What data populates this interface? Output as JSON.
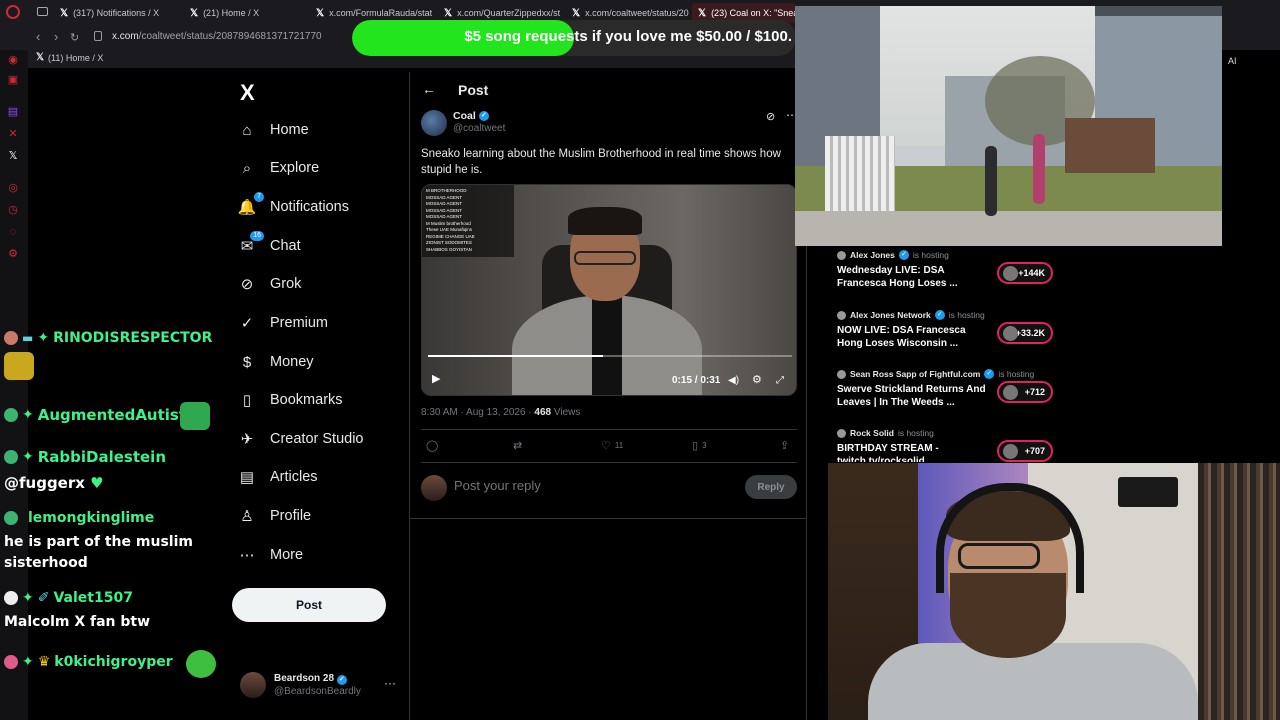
{
  "browser": {
    "tabs": [
      {
        "label": "(317) Notifications / X",
        "active": false
      },
      {
        "label": "(21) Home / X",
        "active": false
      },
      {
        "label": "x.com/FormulaRauda/stat",
        "active": false
      },
      {
        "label": "x.com/QuarterZippedxx/st",
        "active": false
      },
      {
        "label": "x.com/coaltweet/status/20",
        "active": false
      },
      {
        "label": "(23) Coal on X: \"Sneak",
        "active": true
      }
    ],
    "url_host": "x.com",
    "url_path": "/coaltweet/status/2087894681371721770",
    "bookmark": "(11) Home / X",
    "ai_label": "AI"
  },
  "banner": {
    "text": "$5 song requests if you love me $50.00 / $100.",
    "progress": 0.5,
    "color": "#22e51e"
  },
  "chat": {
    "messages": [
      {
        "user": "RINODISRESPECTOR",
        "user_color": "#3df28b",
        "text": ""
      },
      {
        "user": "AugmentedAutist",
        "user_color": "#3df28b",
        "text": ""
      },
      {
        "user": "RabbiDalestein",
        "user_color": "#3df28b",
        "text": "@fuggerx"
      },
      {
        "user": "lemongkinglime",
        "user_color": "#3df28b",
        "text": "he is part of the muslim sisterhood"
      },
      {
        "user": "Valet1507",
        "user_color": "#3df28b",
        "text": "Malcolm X fan btw"
      },
      {
        "user": "k0kichigroyper",
        "user_color": "#3df28b",
        "text": ""
      }
    ],
    "lemong_line1": "he is part of the muslim",
    "lemong_line2": "sisterhood"
  },
  "sidebar": {
    "logo": "X",
    "items": [
      {
        "label": "Home",
        "icon": "home-icon",
        "glyph": "⌂"
      },
      {
        "label": "Explore",
        "icon": "search-icon",
        "glyph": "⌕"
      },
      {
        "label": "Notifications",
        "icon": "bell-icon",
        "glyph": "🔔",
        "badge": "7"
      },
      {
        "label": "Chat",
        "icon": "chat-icon",
        "glyph": "✉",
        "badge": "16"
      },
      {
        "label": "Grok",
        "icon": "grok-icon",
        "glyph": "⊘"
      },
      {
        "label": "Premium",
        "icon": "premium-icon",
        "glyph": "✓"
      },
      {
        "label": "Money",
        "icon": "money-icon",
        "glyph": "$"
      },
      {
        "label": "Bookmarks",
        "icon": "bookmark-icon",
        "glyph": "▯"
      },
      {
        "label": "Creator Studio",
        "icon": "rocket-icon",
        "glyph": "✈"
      },
      {
        "label": "Articles",
        "icon": "article-icon",
        "glyph": "▤"
      },
      {
        "label": "Profile",
        "icon": "profile-icon",
        "glyph": "♙"
      },
      {
        "label": "More",
        "icon": "more-icon",
        "glyph": "⋯"
      }
    ],
    "post_button": "Post",
    "account": {
      "name": "Beardson 28",
      "handle": "@BeardsonBeardly",
      "more": "···"
    }
  },
  "post": {
    "header": "Post",
    "author_name": "Coal",
    "author_handle": "@coaltweet",
    "text": "Sneako learning about the Muslim Brotherhood in real time shows how stupid he is.",
    "video": {
      "overlay_lines": [
        "M BROTHERHOOD",
        "MOSSAD AGENT",
        "MOSSAD AGENT",
        "MOSSAD AGENT",
        "MOSSAD AGENT",
        "M Muslim brotherhood",
        "These UAE Munafiqins",
        "REGIME CHANGE UAE",
        "ZIONIST SODOMITES",
        "SHABBOS GOYISTAN"
      ],
      "time": "0:15 / 0:31",
      "progress": 0.48
    },
    "time": "8:30 AM · Aug 13, 2026 · ",
    "views_count": "468",
    "views_label": " Views",
    "likes": "11",
    "bookmarks": "3",
    "reply_placeholder": "Post your reply",
    "reply_button": "Reply"
  },
  "hosting": {
    "items": [
      {
        "name": "Alex Jones",
        "verified": true,
        "status": "is hosting",
        "title": "Wednesday LIVE: DSA Francesca Hong Loses ...",
        "count": "+144K"
      },
      {
        "name": "Alex Jones Network",
        "verified": true,
        "status": "is hosting",
        "title": "NOW LIVE: DSA Francesca Hong Loses Wisconsin ...",
        "count": "+33.2K"
      },
      {
        "name": "Sean Ross Sapp of Fightful.com",
        "verified": true,
        "status": "is hosting",
        "title": "Swerve Strickland Returns And Leaves | In The Weeds ...",
        "count": "+712"
      },
      {
        "name": "Rock Solid",
        "verified": false,
        "status": "is hosting",
        "title": "BIRTHDAY STREAM - twitch.tv/rocksolid",
        "count": "+707"
      }
    ]
  }
}
